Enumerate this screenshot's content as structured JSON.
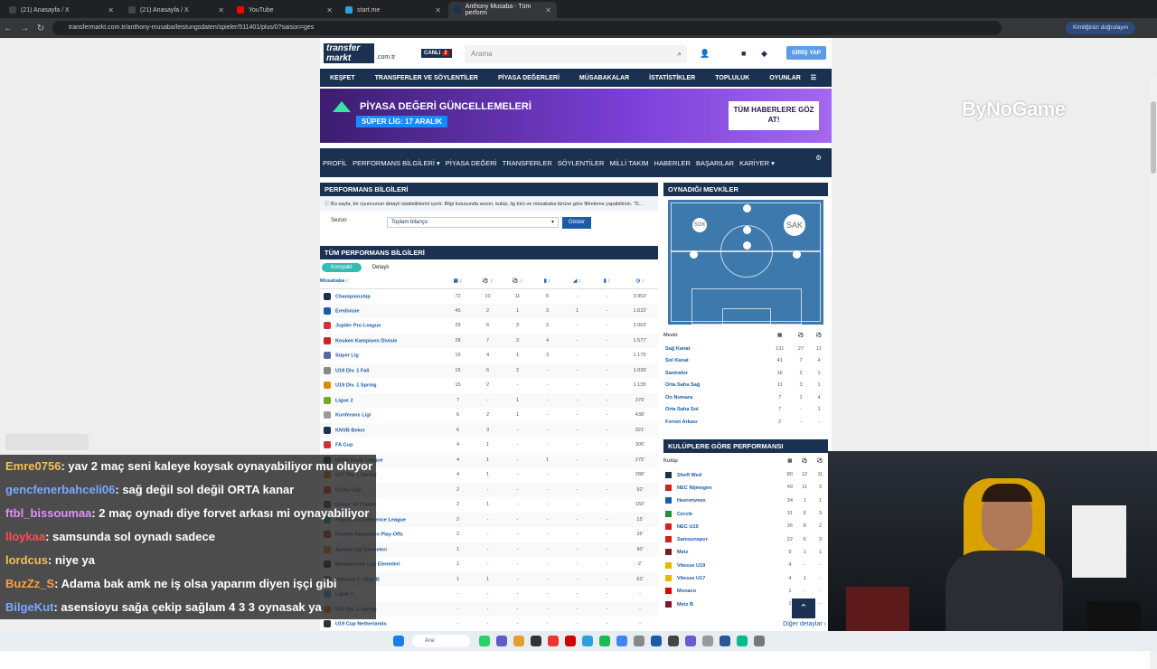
{
  "browser": {
    "tabs": [
      {
        "label": "(21) Anasayfa / X",
        "color": "#444444"
      },
      {
        "label": "(21) Anasayfa / X",
        "color": "#444444"
      },
      {
        "label": "YouTube",
        "color": "#ff0000"
      },
      {
        "label": "start.me",
        "color": "#2aa1d8"
      },
      {
        "label": "Anthony Musaba - Tüm perform",
        "color": "#1a3151"
      }
    ],
    "url": "transfermarkt.com.tr/anthony-musaba/leistungsdaten/spieler/511401/plus/0?saison=ges",
    "verify_label": "Kimliğinizi doğrulayın"
  },
  "site": {
    "logo_line1": "transfer",
    "logo_line2": "markt",
    "tld": ".com.tr",
    "live_label": "CANLI",
    "live_count": "2",
    "search_placeholder": "Arama",
    "login_label": "GİRİŞ YAP",
    "main_nav": [
      "KEŞFET",
      "TRANSFERLER VE SÖYLENTİLER",
      "PİYASA DEĞERLERİ",
      "MÜSABAKALAR",
      "İSTATİSTİKLER",
      "TOPLULUK",
      "OYUNLAR"
    ],
    "banner": {
      "title": "PİYASA DEĞERİ GÜNCELLEMELERİ",
      "sub": "SÜPER LİG: 17 ARALIK",
      "cta": "TÜM HABERLERE GÖZ AT!"
    },
    "profile_nav": [
      "PROFİL",
      "PERFORMANS BİLGİLERİ ▾",
      "PİYASA DEĞERİ",
      "TRANSFERLER",
      "SÖYLENTİLER",
      "MİLLİ TAKIM",
      "HABERLER",
      "BAŞARILAR",
      "KARİYER ▾"
    ]
  },
  "performance": {
    "title": "PERFORMANS BİLGİLERİ",
    "info": "Bu sayfa, bir oyuncunun detaylı istatistiklerini içerir. Bilgi kutusunda sezon, kulüp, lig türü ve müsabaka türüne göre filtreleme yapabilirsin. \"D...",
    "season_label": "Sezon:",
    "season_value": "Toplam bilanço",
    "show_button": "Göster"
  },
  "all_perf": {
    "title": "TÜM PERFORMANS BİLGİLERİ",
    "tabs": [
      "Kompakt",
      "Detaylı"
    ],
    "head": [
      "Müsabaka ↕",
      "▦ ↕",
      "⚽ ↕",
      "⚽ ↕",
      "▮ ↕",
      "◢ ↕",
      "▮ ↕",
      "◷ ↕"
    ],
    "rows": [
      [
        "Championship",
        "72",
        "10",
        "11",
        "6",
        "-",
        "-",
        "3.953'"
      ],
      [
        "Eredivisie",
        "45",
        "2",
        "1",
        "3",
        "1",
        "-",
        "1.632'"
      ],
      [
        "Jupiler Pro League",
        "29",
        "6",
        "3",
        "2",
        "-",
        "-",
        "2.063'"
      ],
      [
        "Keuken Kampioen Divisie",
        "28",
        "7",
        "3",
        "4",
        "-",
        "-",
        "1.577'"
      ],
      [
        "Süper Lig",
        "15",
        "4",
        "1",
        "3",
        "-",
        "-",
        "1.175'"
      ],
      [
        "U19 Div. 1 Fall",
        "15",
        "6",
        "2",
        "-",
        "-",
        "-",
        "1.036'"
      ],
      [
        "U19 Div. 1 Spring",
        "15",
        "2",
        "-",
        "-",
        "-",
        "-",
        "1.135'"
      ],
      [
        "Ligue 2",
        "7",
        "-",
        "1",
        "-",
        "-",
        "-",
        "376'"
      ],
      [
        "Konferans Ligi",
        "6",
        "2",
        "1",
        "-",
        "-",
        "-",
        "438'"
      ],
      [
        "KNVB Beker",
        "6",
        "3",
        "-",
        "-",
        "-",
        "-",
        "321'"
      ],
      [
        "FA Cup",
        "4",
        "1",
        "-",
        "-",
        "-",
        "-",
        "300'"
      ],
      [
        "UEFA Youth League",
        "4",
        "1",
        "-",
        "1",
        "-",
        "-",
        "275'"
      ],
      [
        "U17 Div. 1 Spring",
        "4",
        "1",
        "-",
        "-",
        "-",
        "-",
        "288'"
      ],
      [
        "Croky Cup",
        "2",
        "-",
        "-",
        "-",
        "-",
        "-",
        "92'"
      ],
      [
        "Coupe de France",
        "2",
        "1",
        "-",
        "-",
        "-",
        "-",
        "150'"
      ],
      [
        "Play-Offs Conference League",
        "2",
        "-",
        "-",
        "-",
        "-",
        "-",
        "15'"
      ],
      [
        "Keuken Kampioen Play-Offs",
        "2",
        "-",
        "-",
        "-",
        "-",
        "-",
        "35'"
      ],
      [
        "Avrupa Ligi Elemeleri",
        "1",
        "-",
        "-",
        "-",
        "-",
        "-",
        "90'"
      ],
      [
        "Şampiyonlar Ligi Elemeleri",
        "1",
        "-",
        "-",
        "-",
        "-",
        "-",
        "2'"
      ],
      [
        "National 2 - Grp. B",
        "1",
        "1",
        "-",
        "-",
        "-",
        "-",
        "63'"
      ],
      [
        "Ligue 1",
        "-",
        "-",
        "-",
        "-",
        "-",
        "-",
        "-"
      ],
      [
        "U19 Div. 2 Spring",
        "-",
        "-",
        "-",
        "-",
        "-",
        "-",
        "-"
      ],
      [
        "U19 Cup Netherlands",
        "-",
        "-",
        "-",
        "-",
        "-",
        "-",
        "-"
      ]
    ]
  },
  "positions": {
    "title": "OYNADIĞI MEVKİLER",
    "pitch_labels": [
      "SOK",
      "SAK"
    ],
    "head": [
      "Mevki",
      "▦",
      "⚽",
      "⚽"
    ],
    "rows": [
      [
        "Sağ Kanat",
        "131",
        "27",
        "11"
      ],
      [
        "Sol Kanat",
        "41",
        "7",
        "4"
      ],
      [
        "Santrafor",
        "16",
        "2",
        "1"
      ],
      [
        "Orta Saha Sağ",
        "11",
        "3",
        "1"
      ],
      [
        "On Numara",
        "7",
        "1",
        "4"
      ],
      [
        "Orta Saha Sol",
        "7",
        "-",
        "1"
      ],
      [
        "Forvet Arkası",
        "2",
        "-",
        "-"
      ]
    ]
  },
  "clubs": {
    "title": "KULÜPLERE GÖRE PERFORMANSI",
    "head": [
      "Kulüp",
      "▦",
      "⚽",
      "⚽"
    ],
    "rows": [
      [
        "Sheff Wed",
        "80",
        "12",
        "11"
      ],
      [
        "NEC Nijmegen",
        "49",
        "11",
        "3"
      ],
      [
        "Heerenveen",
        "34",
        "1",
        "1"
      ],
      [
        "Cercle",
        "31",
        "6",
        "3"
      ],
      [
        "NEC U19",
        "26",
        "8",
        "2"
      ],
      [
        "Samsunspor",
        "22",
        "6",
        "3"
      ],
      [
        "Metz",
        "9",
        "1",
        "1"
      ],
      [
        "Vitesse U19",
        "4",
        "-",
        "-"
      ],
      [
        "Vitesse U17",
        "4",
        "1",
        "-"
      ],
      [
        "Monaco",
        "1",
        "-",
        "-"
      ],
      [
        "Metz B",
        "1",
        "1",
        "-"
      ]
    ],
    "more": "Diğer detaylar ›"
  },
  "stream": {
    "watermark_a": "By",
    "watermark_b": "NoGame",
    "chat": [
      {
        "user": "Emre0756",
        "color": "#f2c14e",
        "msg": ": yav 2 maç seni kaleye koysak oynayabiliyor mu oluyor"
      },
      {
        "user": "gencfenerbahceli06",
        "color": "#7aa8ff",
        "msg": ": sağ değil sol değil ORTA kanar"
      },
      {
        "user": "ftbl_bissoumaa",
        "color": "#e08fff",
        "msg": ": 2 maç oynadı diye forvet arkası mi oynayabiliyor"
      },
      {
        "user": "lloykaa",
        "color": "#ff4d4d",
        "msg": ": samsunda sol oynadı sadece"
      },
      {
        "user": "lordcus",
        "color": "#f2c14e",
        "msg": ": niye ya"
      },
      {
        "user": "BuzZz_S",
        "color": "#ff9f43",
        "msg": ": Adama bak amk ne iş olsa yaparım diyen işçi gibi"
      },
      {
        "user": "BilgeKut",
        "color": "#7aa8ff",
        "msg": ": asensioyu sağa çekip sağlam 4 3 3 oynasak ya"
      }
    ],
    "taskbar_search": "Ara"
  }
}
